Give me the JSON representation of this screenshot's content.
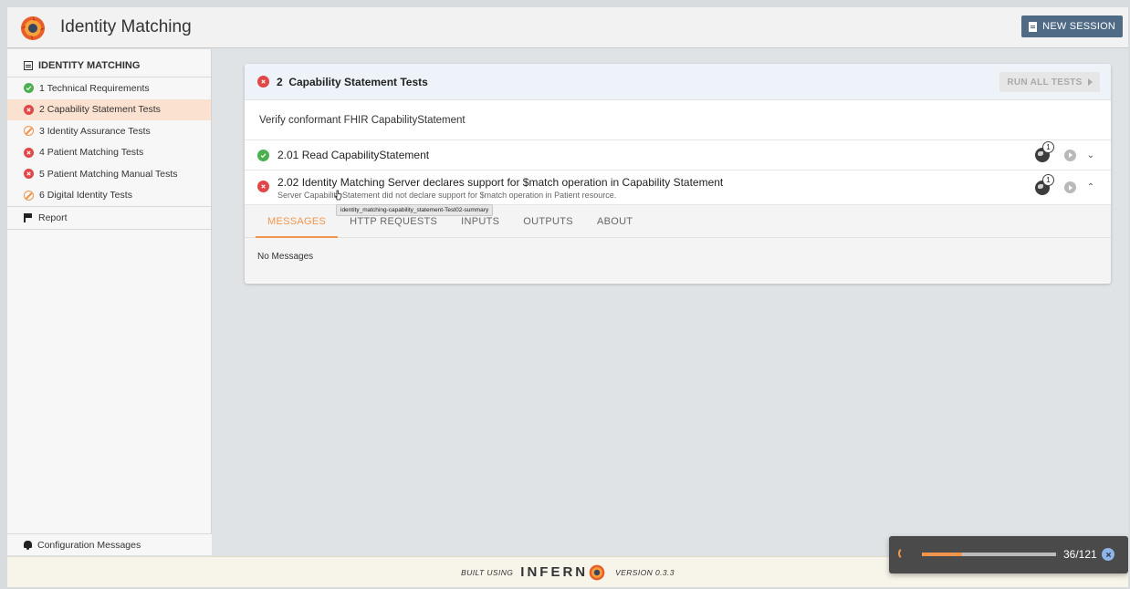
{
  "header": {
    "title": "Identity Matching",
    "new_session_label": "NEW SESSION"
  },
  "sidebar": {
    "heading": "IDENTITY MATCHING",
    "items": [
      {
        "label": "1 Technical Requirements",
        "status": "pass"
      },
      {
        "label": "2 Capability Statement Tests",
        "status": "fail",
        "active": true
      },
      {
        "label": "3 Identity Assurance Tests",
        "status": "skip"
      },
      {
        "label": "4 Patient Matching Tests",
        "status": "fail"
      },
      {
        "label": "5 Patient Matching Manual Tests",
        "status": "fail"
      },
      {
        "label": "6 Digital Identity Tests",
        "status": "skip"
      }
    ],
    "report_label": "Report",
    "config_label": "Configuration Messages"
  },
  "group": {
    "title": "2  Capability Statement Tests",
    "run_all_label": "RUN ALL TESTS",
    "description": "Verify conformant FHIR CapabilityStatement",
    "tests": [
      {
        "title": "2.01 Read CapabilityStatement",
        "status": "pass",
        "request_count": "1",
        "chevron": "⌄"
      },
      {
        "title": "2.02 Identity Matching Server declares support for $match operation in Capability Statement",
        "subtitle": "Server Capability Statement did not declare support for $match operation in Patient resource.",
        "status": "fail",
        "request_count": "1",
        "chevron": "⌃"
      }
    ],
    "tabs": [
      "MESSAGES",
      "HTTP REQUESTS",
      "INPUTS",
      "OUTPUTS",
      "ABOUT"
    ],
    "active_tab": "MESSAGES",
    "tab_content": "No Messages",
    "tooltip": "identity_matching-capability_statement-Test02-summary"
  },
  "footer": {
    "built": "BUILT USING",
    "brand_left": "INFERN",
    "version": "VERSION 0.3.3"
  },
  "progress": {
    "count": "36/121",
    "completed": 36,
    "total": 121
  },
  "colors": {
    "accent": "#f0954b",
    "pass": "#4caf50",
    "fail": "#e04848",
    "header_button": "#4f6b86"
  }
}
